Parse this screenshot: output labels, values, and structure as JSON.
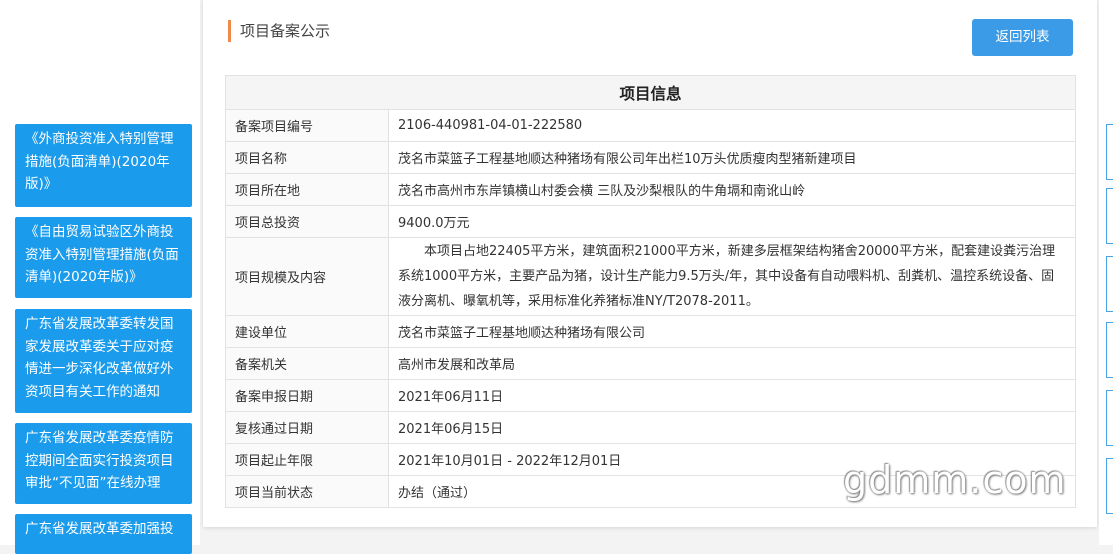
{
  "sidebar": {
    "links": [
      {
        "label": "《外商投资准入特别管理措施(负面清单)(2020年版)》"
      },
      {
        "label": "《自由贸易试验区外商投资准入特别管理措施(负面清单)(2020年版)》"
      },
      {
        "label": "广东省发展改革委转发国家发展改革委关于应对疫情进一步深化改革做好外资项目有关工作的通知"
      },
      {
        "label": "广东省发展改革委疫情防控期间全面实行投资项目审批“不见面”在线办理"
      },
      {
        "label": "广东省发展改革委加强投"
      }
    ]
  },
  "page": {
    "title": "项目备案公示",
    "back_label": "返回列表",
    "table_title": "项目信息"
  },
  "rows": [
    {
      "label": "备案项目编号",
      "value": "2106-440981-04-01-222580"
    },
    {
      "label": "项目名称",
      "value": "茂名市菜篮子工程基地顺达种猪场有限公司年出栏10万头优质瘦肉型猪新建项目"
    },
    {
      "label": "项目所在地",
      "value": "茂名市高州市东岸镇横山村委会横 三队及沙梨根队的牛角塥和南讹山岭"
    },
    {
      "label": "项目总投资",
      "value": "9400.0万元"
    },
    {
      "label": "项目规模及内容",
      "value": "本项目占地22405平方米，建筑面积21000平方米，新建多层框架结构猪舍20000平方米，配套建设粪污治理系统1000平方米，主要产品为猪，设计生产能力9.5万头/年，其中设备有自动喂料机、刮粪机、温控系统设备、固液分离机、曝氧机等，采用标准化养猪标准NY/T2078-2011。"
    },
    {
      "label": "建设单位",
      "value": "茂名市菜篮子工程基地顺达种猪场有限公司"
    },
    {
      "label": "备案机关",
      "value": "高州市发展和改革局"
    },
    {
      "label": "备案申报日期",
      "value": "2021年06月11日"
    },
    {
      "label": "复核通过日期",
      "value": "2021年06月15日"
    },
    {
      "label": "项目起止年限",
      "value": "2021年10月01日 - 2022年12月01日"
    },
    {
      "label": "项目当前状态",
      "value": "办结（通过）"
    }
  ],
  "watermark": "gdmm.com",
  "colors": {
    "sidebar_link": "#1a9bec",
    "back_button": "#3b9be6",
    "title_accent": "#f08a4b"
  }
}
